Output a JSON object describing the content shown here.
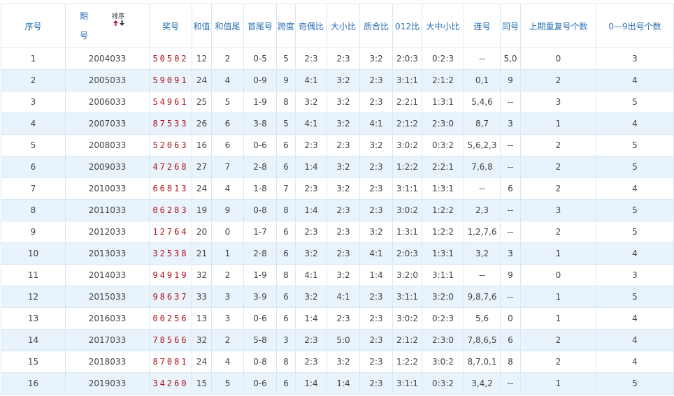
{
  "headers": {
    "index": "序号",
    "period_top": "期",
    "period_bottom": "号",
    "sort": "排序",
    "number": "奖号",
    "sum": "和值",
    "sum_tail": "和值尾",
    "first_last": "首尾号",
    "span": "跨度",
    "odd_even": "奇偶比",
    "big_small": "大小比",
    "prime_composite": "质合比",
    "mod012": "012比",
    "big_mid_small": "大中小比",
    "consecutive": "连号",
    "same": "同号",
    "repeat_prev": "上期重复号个数",
    "digits_0_9": "0—9出号个数"
  },
  "sort_arrows": {
    "up_color": "#c8102e",
    "down_color": "#333333"
  },
  "rows": [
    {
      "idx": "1",
      "period": "2004033",
      "num": "50502",
      "sum": "12",
      "tail": "2",
      "fl": "0-5",
      "span": "5",
      "oe": "2:3",
      "bs": "2:3",
      "pc": "3:2",
      "m012": "2:0:3",
      "bms": "0:2:3",
      "cons": "--",
      "same": "5,0",
      "rep": "0",
      "d09": "3"
    },
    {
      "idx": "2",
      "period": "2005033",
      "num": "59091",
      "sum": "24",
      "tail": "4",
      "fl": "0-9",
      "span": "9",
      "oe": "4:1",
      "bs": "3:2",
      "pc": "2:3",
      "m012": "3:1:1",
      "bms": "2:1:2",
      "cons": "0,1",
      "same": "9",
      "rep": "2",
      "d09": "4"
    },
    {
      "idx": "3",
      "period": "2006033",
      "num": "54961",
      "sum": "25",
      "tail": "5",
      "fl": "1-9",
      "span": "8",
      "oe": "3:2",
      "bs": "3:2",
      "pc": "2:3",
      "m012": "2:2:1",
      "bms": "1:3:1",
      "cons": "5,4,6",
      "same": "--",
      "rep": "3",
      "d09": "5"
    },
    {
      "idx": "4",
      "period": "2007033",
      "num": "87533",
      "sum": "26",
      "tail": "6",
      "fl": "3-8",
      "span": "5",
      "oe": "4:1",
      "bs": "3:2",
      "pc": "4:1",
      "m012": "2:1:2",
      "bms": "2:3:0",
      "cons": "8,7",
      "same": "3",
      "rep": "1",
      "d09": "4"
    },
    {
      "idx": "5",
      "period": "2008033",
      "num": "52063",
      "sum": "16",
      "tail": "6",
      "fl": "0-6",
      "span": "6",
      "oe": "2:3",
      "bs": "2:3",
      "pc": "3:2",
      "m012": "3:0:2",
      "bms": "0:3:2",
      "cons": "5,6,2,3",
      "same": "--",
      "rep": "2",
      "d09": "5"
    },
    {
      "idx": "6",
      "period": "2009033",
      "num": "47268",
      "sum": "27",
      "tail": "7",
      "fl": "2-8",
      "span": "6",
      "oe": "1:4",
      "bs": "3:2",
      "pc": "2:3",
      "m012": "1:2:2",
      "bms": "2:2:1",
      "cons": "7,6,8",
      "same": "--",
      "rep": "2",
      "d09": "5"
    },
    {
      "idx": "7",
      "period": "2010033",
      "num": "66813",
      "sum": "24",
      "tail": "4",
      "fl": "1-8",
      "span": "7",
      "oe": "2:3",
      "bs": "3:2",
      "pc": "2:3",
      "m012": "3:1:1",
      "bms": "1:3:1",
      "cons": "--",
      "same": "6",
      "rep": "2",
      "d09": "4"
    },
    {
      "idx": "8",
      "period": "2011033",
      "num": "06283",
      "sum": "19",
      "tail": "9",
      "fl": "0-8",
      "span": "8",
      "oe": "1:4",
      "bs": "2:3",
      "pc": "2:3",
      "m012": "3:0:2",
      "bms": "1:2:2",
      "cons": "2,3",
      "same": "--",
      "rep": "3",
      "d09": "5"
    },
    {
      "idx": "9",
      "period": "2012033",
      "num": "12764",
      "sum": "20",
      "tail": "0",
      "fl": "1-7",
      "span": "6",
      "oe": "2:3",
      "bs": "2:3",
      "pc": "3:2",
      "m012": "1:3:1",
      "bms": "1:2:2",
      "cons": "1,2,7,6",
      "same": "--",
      "rep": "2",
      "d09": "5"
    },
    {
      "idx": "10",
      "period": "2013033",
      "num": "32538",
      "sum": "21",
      "tail": "1",
      "fl": "2-8",
      "span": "6",
      "oe": "3:2",
      "bs": "2:3",
      "pc": "4:1",
      "m012": "2:0:3",
      "bms": "1:3:1",
      "cons": "3,2",
      "same": "3",
      "rep": "1",
      "d09": "4"
    },
    {
      "idx": "11",
      "period": "2014033",
      "num": "94919",
      "sum": "32",
      "tail": "2",
      "fl": "1-9",
      "span": "8",
      "oe": "4:1",
      "bs": "3:2",
      "pc": "1:4",
      "m012": "3:2:0",
      "bms": "3:1:1",
      "cons": "--",
      "same": "9",
      "rep": "0",
      "d09": "3"
    },
    {
      "idx": "12",
      "period": "2015033",
      "num": "98637",
      "sum": "33",
      "tail": "3",
      "fl": "3-9",
      "span": "6",
      "oe": "3:2",
      "bs": "4:1",
      "pc": "2:3",
      "m012": "3:1:1",
      "bms": "3:2:0",
      "cons": "9,8,7,6",
      "same": "--",
      "rep": "1",
      "d09": "5"
    },
    {
      "idx": "13",
      "period": "2016033",
      "num": "00256",
      "sum": "13",
      "tail": "3",
      "fl": "0-6",
      "span": "6",
      "oe": "1:4",
      "bs": "2:3",
      "pc": "2:3",
      "m012": "3:0:2",
      "bms": "0:2:3",
      "cons": "5,6",
      "same": "0",
      "rep": "1",
      "d09": "4"
    },
    {
      "idx": "14",
      "period": "2017033",
      "num": "78566",
      "sum": "32",
      "tail": "2",
      "fl": "5-8",
      "span": "3",
      "oe": "2:3",
      "bs": "5:0",
      "pc": "2:3",
      "m012": "2:1:2",
      "bms": "2:3:0",
      "cons": "7,8,6,5",
      "same": "6",
      "rep": "2",
      "d09": "4"
    },
    {
      "idx": "15",
      "period": "2018033",
      "num": "87081",
      "sum": "24",
      "tail": "4",
      "fl": "0-8",
      "span": "8",
      "oe": "2:3",
      "bs": "3:2",
      "pc": "2:3",
      "m012": "1:2:2",
      "bms": "3:0:2",
      "cons": "8,7,0,1",
      "same": "8",
      "rep": "2",
      "d09": "4"
    },
    {
      "idx": "16",
      "period": "2019033",
      "num": "34260",
      "sum": "15",
      "tail": "5",
      "fl": "0-6",
      "span": "6",
      "oe": "1:4",
      "bs": "1:4",
      "pc": "2:3",
      "m012": "3:1:1",
      "bms": "0:3:2",
      "cons": "3,4,2",
      "same": "--",
      "rep": "1",
      "d09": "5"
    }
  ]
}
